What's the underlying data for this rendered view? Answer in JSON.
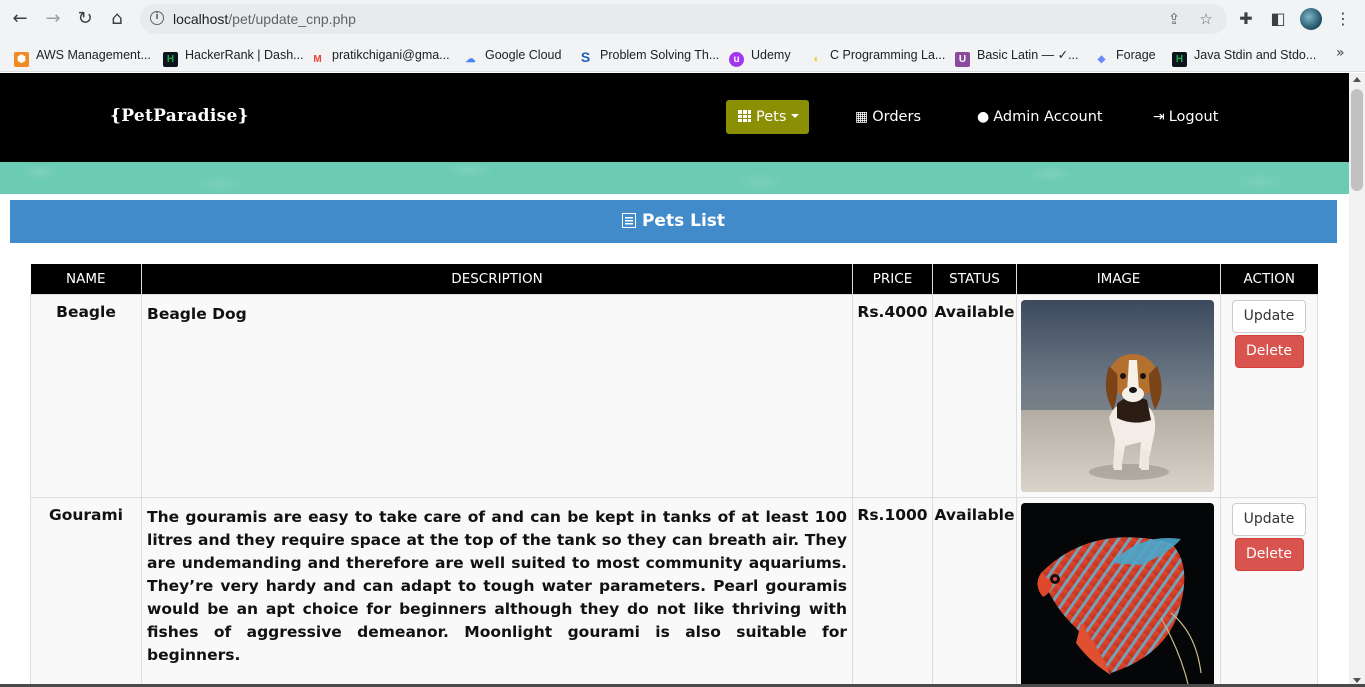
{
  "browser": {
    "url_host": "localhost",
    "url_path": "/pet/update_cnp.php",
    "bookmarks": [
      {
        "label": "AWS Management...",
        "icon": "aws-icon",
        "color": "#f08a24"
      },
      {
        "label": "HackerRank | Dash...",
        "icon": "hackerrank-icon",
        "color": "#1ba94c"
      },
      {
        "label": "pratikchigani@gma...",
        "icon": "gmail-icon",
        "color": "#ea4335"
      },
      {
        "label": "Google Cloud",
        "icon": "google-cloud-icon",
        "color": "#4285f4"
      },
      {
        "label": "Problem Solving Th...",
        "icon": "s-icon",
        "color": "#1e5eb8"
      },
      {
        "label": "Udemy",
        "icon": "udemy-icon",
        "color": "#a435f0"
      },
      {
        "label": "C Programming La...",
        "icon": "c-lang-icon",
        "color": "#f0c419"
      },
      {
        "label": "Basic Latin — ✓...",
        "icon": "unicode-icon",
        "color": "#8a4a9e"
      },
      {
        "label": "Forage",
        "icon": "forage-icon",
        "color": "#6b8cff"
      },
      {
        "label": "Java Stdin and Stdo...",
        "icon": "hackerrank-icon",
        "color": "#1ba94c"
      }
    ]
  },
  "navbar": {
    "brand": "{PetParadise}",
    "pets": "Pets",
    "orders": "Orders",
    "admin": "Admin Account",
    "logout": "Logout",
    "accent": "#8a8f04"
  },
  "list_title": "Pets List",
  "table": {
    "headers": [
      "NAME",
      "DESCRIPTION",
      "PRICE",
      "STATUS",
      "IMAGE",
      "ACTION"
    ],
    "rows": [
      {
        "name": "Beagle",
        "description": "Beagle Dog",
        "price": "Rs.4000",
        "status": "Available",
        "image": "beagle-photo"
      },
      {
        "name": "Gourami",
        "description": "The gouramis are easy to take care of and can be kept in tanks of at least 100 litres and they require space at the top of the tank so they can breath air. They are undemanding and therefore are well suited to most community aquariums. They’re very hardy and can adapt to tough water parameters. Pearl gouramis would be an apt choice for beginners although they do not like thriving with fishes of aggressive demeanor. Moonlight gourami is also suitable for beginners.",
        "price": "Rs.1000",
        "status": "Available",
        "image": "gourami-photo"
      }
    ],
    "update_label": "Update",
    "delete_label": "Delete"
  }
}
